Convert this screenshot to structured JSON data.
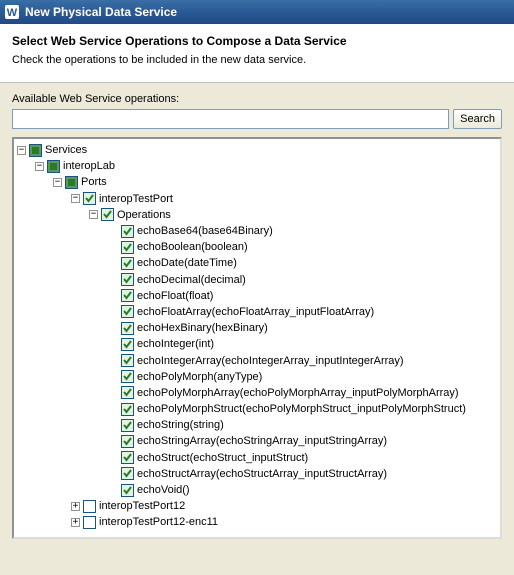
{
  "window": {
    "title": "New Physical Data Service"
  },
  "header": {
    "title": "Select Web Service Operations to Compose a Data Service",
    "description": "Check the operations to be included in the new data service."
  },
  "search": {
    "label": "Available Web Service operations:",
    "placeholder": "",
    "button": "Search"
  },
  "tree": {
    "root": {
      "label": "Services",
      "children": {
        "interopLab": {
          "label": "interopLab",
          "ports": {
            "label": "Ports",
            "interopTestPort": {
              "label": "interopTestPort",
              "operations_label": "Operations",
              "operations": [
                "echoBase64(base64Binary)",
                "echoBoolean(boolean)",
                "echoDate(dateTime)",
                "echoDecimal(decimal)",
                "echoFloat(float)",
                "echoFloatArray(echoFloatArray_inputFloatArray)",
                "echoHexBinary(hexBinary)",
                "echoInteger(int)",
                "echoIntegerArray(echoIntegerArray_inputIntegerArray)",
                "echoPolyMorph(anyType)",
                "echoPolyMorphArray(echoPolyMorphArray_inputPolyMorphArray)",
                "echoPolyMorphStruct(echoPolyMorphStruct_inputPolyMorphStruct)",
                "echoString(string)",
                "echoStringArray(echoStringArray_inputStringArray)",
                "echoStruct(echoStruct_inputStruct)",
                "echoStructArray(echoStructArray_inputStructArray)",
                "echoVoid()"
              ]
            },
            "interopTestPort12": {
              "label": "interopTestPort12"
            },
            "interopTestPort12enc11": {
              "label": "interopTestPort12-enc11"
            }
          }
        }
      }
    }
  }
}
